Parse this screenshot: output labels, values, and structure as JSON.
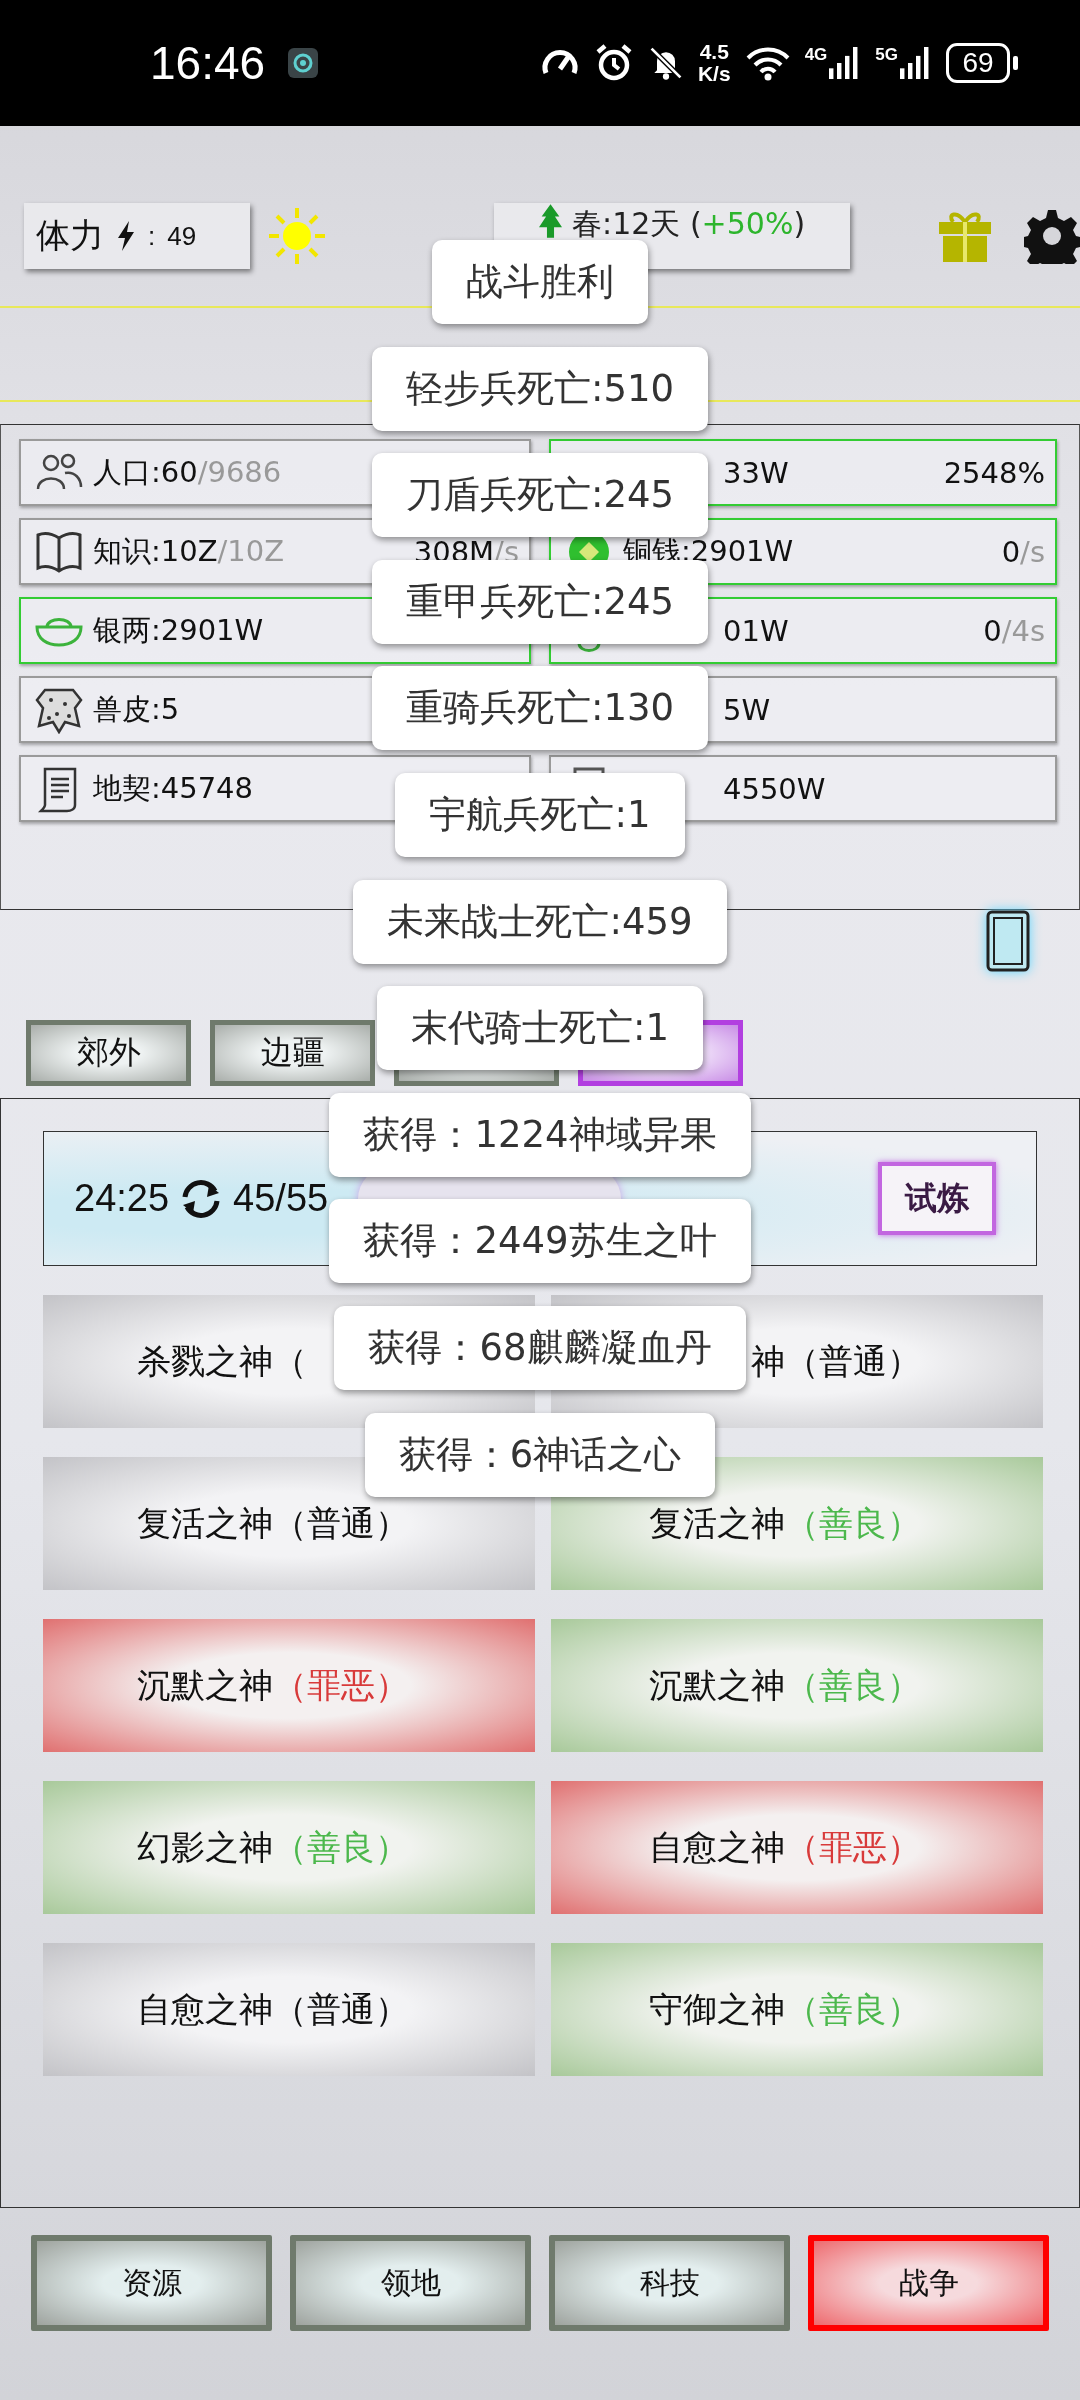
{
  "status_bar": {
    "time": "16:46",
    "speed": "4.5",
    "speed_unit": "K/s",
    "network_1": "4G",
    "network_2": "5G",
    "battery": "69"
  },
  "top_bar": {
    "stamina": {
      "label": "体力",
      "separator": ":",
      "value": "49"
    },
    "season": {
      "text_before": "春:12天 (",
      "bonus": "+50%",
      "text_after": ")"
    }
  },
  "resources": {
    "left": [
      {
        "text": "人口:60",
        "dim": "/9686",
        "highlighted": false
      },
      {
        "text": "知识:10Z",
        "dim": "/10Z",
        "rate": "308M",
        "rate_dim": "/s",
        "highlighted": false
      },
      {
        "text": "银两:2901W",
        "highlighted": true
      },
      {
        "text": "兽皮:5",
        "highlighted": false
      },
      {
        "text": "地契:45748",
        "highlighted": false
      }
    ],
    "right": [
      {
        "text": "33W",
        "rate": "2548%",
        "highlighted": true,
        "kind": "partial"
      },
      {
        "text": "铜钱:2901W",
        "rate": "0",
        "rate_dim": "/s",
        "highlighted": true,
        "kind": "full"
      },
      {
        "text": "01W",
        "rate": "0",
        "rate_dim": "/4s",
        "highlighted": true,
        "kind": "partial"
      },
      {
        "text": "5W",
        "highlighted": false,
        "kind": "partial"
      },
      {
        "text": "4550W",
        "highlighted": false,
        "kind": "partial"
      }
    ]
  },
  "tabs": [
    {
      "label": "郊外",
      "selected": false
    },
    {
      "label": "边疆",
      "selected": false
    },
    {
      "selected": false
    },
    {
      "selected": true
    }
  ],
  "trial": {
    "timer": "24:25",
    "count": "45/55",
    "button": "试炼"
  },
  "gods": [
    {
      "name": "杀戮之神",
      "alignment": "（",
      "kind": "normal"
    },
    {
      "name": "神",
      "alignment": "（普通）",
      "kind": "normal"
    },
    {
      "name": "复活之神",
      "alignment": "（普通）",
      "kind": "normal"
    },
    {
      "name": "复活之神",
      "alignment": "（善良）",
      "kind": "good"
    },
    {
      "name": "沉默之神",
      "alignment": "（罪恶）",
      "kind": "evil"
    },
    {
      "name": "沉默之神",
      "alignment": "（善良）",
      "kind": "good"
    },
    {
      "name": "幻影之神",
      "alignment": "（善良）",
      "kind": "good"
    },
    {
      "name": "自愈之神",
      "alignment": "（罪恶）",
      "kind": "evil"
    },
    {
      "name": "自愈之神",
      "alignment": "（普通）",
      "kind": "normal"
    },
    {
      "name": "守御之神",
      "alignment": "（善良）",
      "kind": "good"
    }
  ],
  "nav": [
    {
      "label": "资源",
      "selected": false
    },
    {
      "label": "领地",
      "selected": false
    },
    {
      "label": "科技",
      "selected": false
    },
    {
      "label": "战争",
      "selected": true
    }
  ],
  "toasts": [
    "战斗胜利",
    "轻步兵死亡:510",
    "刀盾兵死亡:245",
    "重甲兵死亡:245",
    "重骑兵死亡:130",
    "宇航兵死亡:1",
    "未来战士死亡:459",
    "末代骑士死亡:1",
    "获得：1224神域异果",
    "获得：2449苏生之叶",
    "获得：68麒麟凝血丹",
    "获得：6神话之心"
  ]
}
